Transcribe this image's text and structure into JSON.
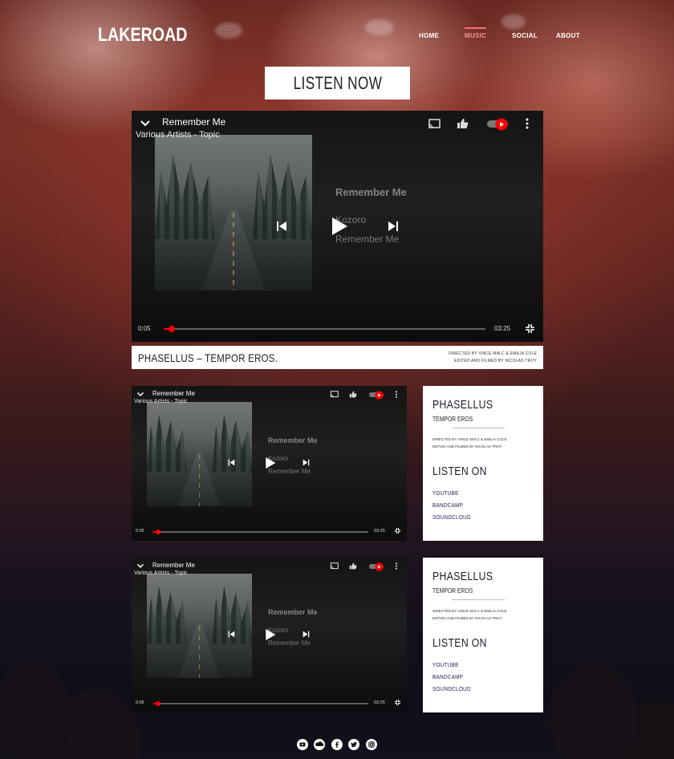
{
  "brand": {
    "logo": "LAKEROAD"
  },
  "nav": {
    "items": [
      "HOME",
      "MUSIC",
      "SOCIAL",
      "ABOUT"
    ],
    "active": "MUSIC"
  },
  "cta": {
    "label": "LISTEN NOW"
  },
  "colors": {
    "accent": "#ff6b6b",
    "youtube_red": "#ff0000",
    "card_bg": "#ffffff"
  },
  "main_player": {
    "title": "Remember Me",
    "channel": "Various Artists - Topic",
    "song": "Remember Me",
    "artist": "Kozoro",
    "album": "Remember Me",
    "current_time": "0:05",
    "duration": "03:25",
    "progress_fraction": 0.024
  },
  "main_caption": {
    "title": "PHASELLUS – TEMPOR EROS.",
    "credit_line1": "DIRECTED BY VINCE MALC & EMILIA COLE",
    "credit_line2": "EDITED AND FILMED BY NICOLAS TROY"
  },
  "players": [
    {
      "title": "Remember Me",
      "channel": "Various Artists - Topic",
      "song": "Remember Me",
      "artist": "Kozoro",
      "album": "Remember Me",
      "current_time": "0:05",
      "duration": "03:25",
      "progress_fraction": 0.024
    },
    {
      "title": "Remember Me",
      "channel": "Various Artists - Topic",
      "song": "Remember Me",
      "artist": "Kozoro",
      "album": "Remember Me",
      "current_time": "0:05",
      "duration": "03:25",
      "progress_fraction": 0.024
    }
  ],
  "cards": [
    {
      "title": "PHASELLUS",
      "subtitle": "TEMPOR EROS",
      "credit_line1": "DIRECTED BY VINCE MALC & EMILIA COLE",
      "credit_line2": "EDITED AND FILMED BY NICOLAS TROY",
      "listen_heading": "LISTEN ON",
      "links": [
        "YOUTUBE",
        "BANDCAMP",
        "SOUNDCLOUD"
      ]
    },
    {
      "title": "PHASELLUS",
      "subtitle": "TEMPOR EROS",
      "credit_line1": "DIRECTED BY VINCE MALC & EMILIA COLE",
      "credit_line2": "EDITED AND FILMED BY NICOLAS TROY",
      "listen_heading": "LISTEN ON",
      "links": [
        "YOUTUBE",
        "BANDCAMP",
        "SOUNDCLOUD"
      ]
    }
  ],
  "social_icons": [
    "youtube-icon",
    "soundcloud-icon",
    "facebook-icon",
    "twitter-icon",
    "instagram-icon"
  ]
}
